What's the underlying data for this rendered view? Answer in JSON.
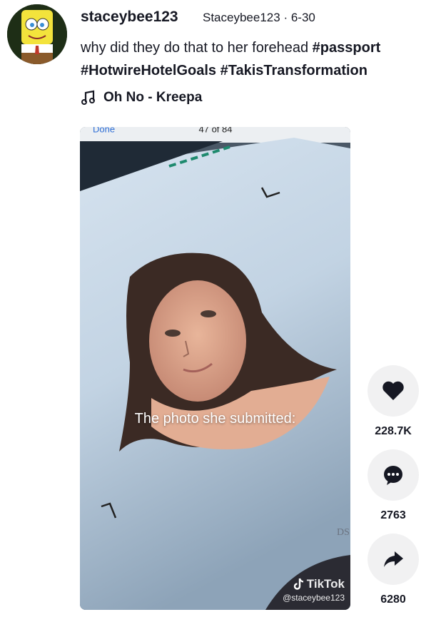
{
  "post": {
    "username": "staceybee123",
    "nickname": "Staceybee123",
    "separator": "·",
    "date": "6-30",
    "caption_text": "why did they do that to her forehead",
    "hashtags": [
      "#passport",
      "#HotwireHotelGoals",
      "#TakisTransformation"
    ],
    "music": "Oh No - Kreepa"
  },
  "video": {
    "overlay_top_left": "Done",
    "overlay_top_center": "47 of 84",
    "caption": "The photo she submitted:",
    "watermark_brand": "TikTok",
    "watermark_handle": "@staceybee123",
    "corner_text": "DS"
  },
  "actions": {
    "likes": "228.7K",
    "comments": "2763",
    "shares": "6280"
  },
  "icons": {
    "like": "heart-icon",
    "comment": "comment-bubble-icon",
    "share": "share-arrow-icon",
    "music": "music-note-icon",
    "brand": "tiktok-logo-icon"
  }
}
